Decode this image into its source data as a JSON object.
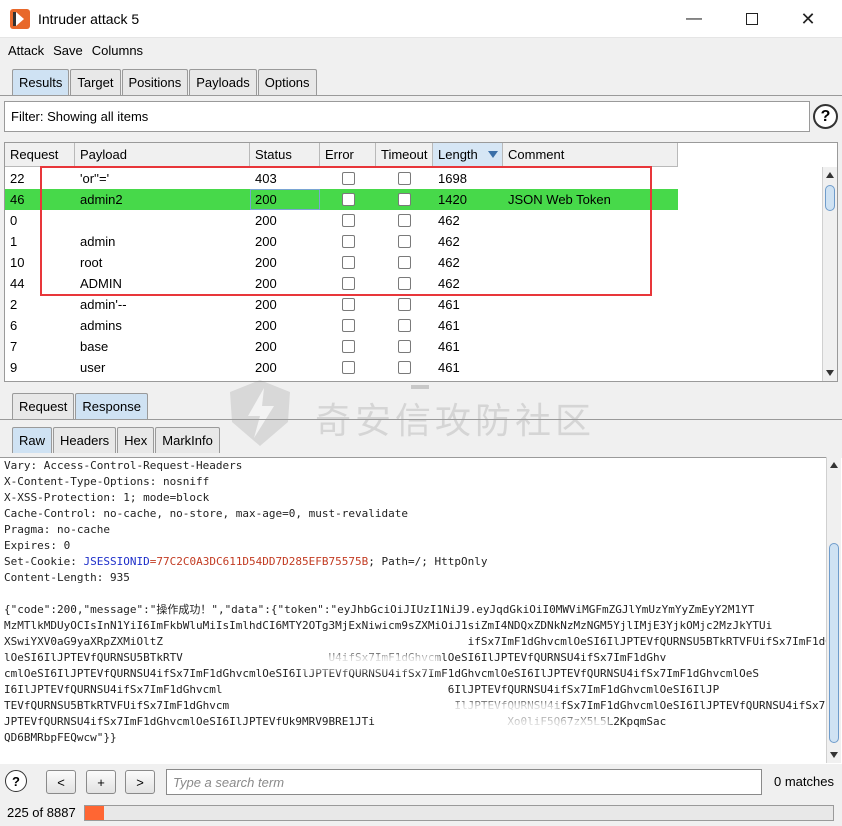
{
  "window": {
    "title": "Intruder attack 5"
  },
  "menu": [
    "Attack",
    "Save",
    "Columns"
  ],
  "main_tabs": [
    "Results",
    "Target",
    "Positions",
    "Payloads",
    "Options"
  ],
  "filter_text": "Filter: Showing all items",
  "table": {
    "columns": [
      "Request",
      "Payload",
      "Status",
      "Error",
      "Timeout",
      "Length",
      "Comment"
    ],
    "sorted_column": "Length",
    "rows": [
      {
        "request": "22",
        "payload": "'or''='",
        "status": "403",
        "error": false,
        "timeout": false,
        "length": "1698",
        "comment": ""
      },
      {
        "request": "46",
        "payload": "admin2",
        "status": "200",
        "error": false,
        "timeout": false,
        "length": "1420",
        "comment": "JSON Web Token",
        "selected": true
      },
      {
        "request": "0",
        "payload": "",
        "status": "200",
        "error": false,
        "timeout": false,
        "length": "462",
        "comment": ""
      },
      {
        "request": "1",
        "payload": "admin",
        "status": "200",
        "error": false,
        "timeout": false,
        "length": "462",
        "comment": ""
      },
      {
        "request": "10",
        "payload": "root",
        "status": "200",
        "error": false,
        "timeout": false,
        "length": "462",
        "comment": ""
      },
      {
        "request": "44",
        "payload": "ADMIN",
        "status": "200",
        "error": false,
        "timeout": false,
        "length": "462",
        "comment": ""
      },
      {
        "request": "2",
        "payload": "admin'--",
        "status": "200",
        "error": false,
        "timeout": false,
        "length": "461",
        "comment": ""
      },
      {
        "request": "6",
        "payload": "admins",
        "status": "200",
        "error": false,
        "timeout": false,
        "length": "461",
        "comment": ""
      },
      {
        "request": "7",
        "payload": "base",
        "status": "200",
        "error": false,
        "timeout": false,
        "length": "461",
        "comment": ""
      },
      {
        "request": "9",
        "payload": "user",
        "status": "200",
        "error": false,
        "timeout": false,
        "length": "461",
        "comment": ""
      }
    ]
  },
  "reqresp_tabs": [
    "Request",
    "Response"
  ],
  "view_tabs": [
    "Raw",
    "Headers",
    "Hex",
    "MarkInfo"
  ],
  "response": {
    "headers": [
      "Vary: Access-Control-Request-Headers",
      "X-Content-Type-Options: nosniff",
      "X-XSS-Protection: 1; mode=block",
      "Cache-Control: no-cache, no-store, max-age=0, must-revalidate",
      "Pragma: no-cache",
      "Expires: 0"
    ],
    "cookie_prefix": "Set-Cookie: ",
    "cookie_name": "JSESSIONID",
    "cookie_eq": "=",
    "cookie_value": "77C2C0A3DC611D54DD7D285EFB75575B",
    "cookie_suffix": "; Path=/; HttpOnly",
    "content_length": "Content-Length: 935",
    "body_lines": [
      "{\"code\":200,\"message\":\"操作成功！\",\"data\":{\"token\":\"eyJhbGciOiJIUzI1NiJ9.eyJqdGkiOiI0MWViMGFmZGJlYmUzYmYyZmEyY2M1YT",
      "MzMTlkMDUyOCIsInN1YiI6ImFkbWluMiIsImlhdCI6MTY2OTg3MjExNiwicm9sZXMiOiJ1siZmI4NDQxZDNkNzMzNGM5YjlIMjE3YjkOMjc2MzJkYTUi",
      "XSwiYXV0aG9yaXRpZXMiOltZ                                              ifSx7ImF1dGhvcmlOeSI6IlJPTEVfQURNSU5BTkRTVFUifSx7ImF1dGhvcm",
      "lOeSI6IlJPTEVfQURNSU5BTkRTV                      U4ifSx7ImF1dGhvcmlOeSI6IlJPTEVfQURNSU4ifSx7ImF1dGhv",
      "cmlOeSI6IlJPTEVfQURNSU4ifSx7ImF1dGhvcmlOeSI6IlJPTEVfQURNSU4ifSx7ImF1dGhvcmlOeSI6IlJPTEVfQURNSU4ifSx7ImF1dGhvcmlOeS",
      "I6IlJPTEVfQURNSU4ifSx7ImF1dGhvcml                                  6IlJPTEVfQURNSU4ifSx7ImF1dGhvcmlOeSI6IlJP",
      "TEVfQURNSU5BTkRTVFUifSx7ImF1dGhvcm                                  IlJPTEVfQURNSU4ifSx7ImF1dGhvcmlOeSI6IlJPTEVfQURNSU4ifSx7ImF1dGhvcmlOeSI6IlJP",
      "JPTEVfQURNSU4ifSx7ImF1dGhvcmlOeSI6IlJPTEVfUk9MRV9BRE1JTi                    Xo0liF5Q67zX5L5L2KpqmSac",
      "QD6BMRbpFEQwcw\"}}"
    ]
  },
  "watermark_text": "奇安信攻防社区",
  "search": {
    "placeholder": "Type a search term",
    "value": ""
  },
  "nav_buttons": [
    "<",
    "+",
    ">"
  ],
  "matches": "0 matches",
  "progress": {
    "label": "225 of 8887",
    "fraction": 0.0253
  },
  "colors": {
    "selected_row": "#47d94a",
    "highlight_box": "#e8363a",
    "progress": "#ff6633"
  }
}
